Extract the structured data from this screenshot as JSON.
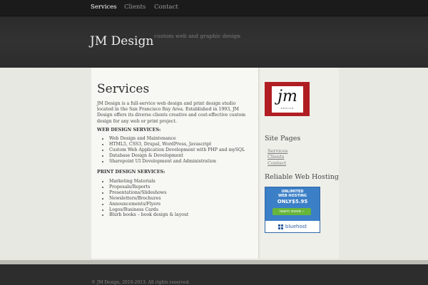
{
  "nav": {
    "items": [
      {
        "label": "Services",
        "active": true
      },
      {
        "label": "Clients",
        "active": false
      },
      {
        "label": "Contact",
        "active": false
      }
    ]
  },
  "header": {
    "title": "JM Design",
    "tagline": "custom web and graphic design"
  },
  "main": {
    "heading": "Services",
    "intro": "JM Design is a full-service web design and print design studio located in the San Francisco Bay Area. Established in 1993, JM Design offers its diverse clients creative and cost-effective custom design for any web or print project.",
    "web": {
      "heading": "WEB DESIGN SERVICES:",
      "items": [
        "Web Design and Maintenance",
        "HTML5, CSS3, Drupal, WordPress, Javascript",
        "Custom Web Application Development with PHP and mySQL",
        "Database Design & Development",
        "Sharepoint UI Development and Administration"
      ]
    },
    "print": {
      "heading": "PRINT DESIGN SERVICES:",
      "items": [
        "Marketing Materials",
        "Proposals/Reports",
        "Presentations/Slideshows",
        "Newsletters/Brochures",
        "Announcements/Flyers",
        "Logos/Business Cards",
        "Blurb books – book design & layout"
      ]
    }
  },
  "sidebar": {
    "logo": {
      "mark": "jm",
      "sub": "DESIGN"
    },
    "site_pages_title": "Site Pages",
    "links": [
      "Services",
      "Clients",
      "Contact"
    ],
    "hosting_title": "Reliable Web Hosting",
    "ad": {
      "line1": "UNLIMITED",
      "line2": "WEB HOSTING",
      "price": "ONLY$5.95",
      "button": "learn more",
      "brand": "bluehost"
    }
  },
  "footer": {
    "copyright": "© JM Design, 2010-2013. All rights reserved."
  },
  "colors": {
    "logo_red": "#b01e23",
    "ad_blue": "#3b7fc7",
    "ad_button_green": "#68b53b"
  }
}
